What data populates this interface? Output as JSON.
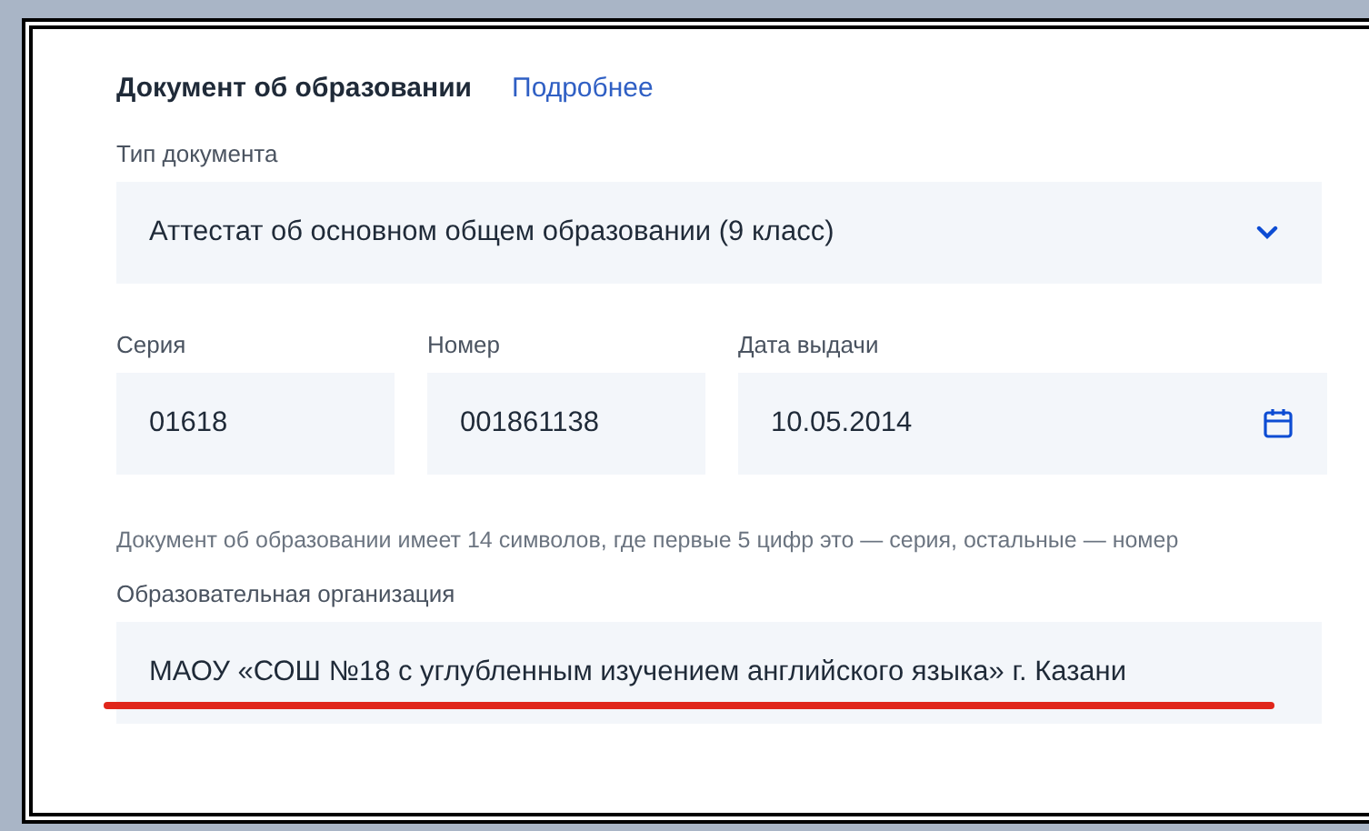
{
  "section": {
    "title": "Документ об образовании",
    "link": "Подробнее"
  },
  "document_type": {
    "label": "Тип документа",
    "value": "Аттестат об основном общем образовании (9 класс)"
  },
  "fields": [
    {
      "label": "Серия",
      "value": "01618",
      "kind": "text"
    },
    {
      "label": "Номер",
      "value": "001861138",
      "kind": "text"
    },
    {
      "label": "Дата выдачи",
      "value": "10.05.2014",
      "kind": "date"
    }
  ],
  "hint": "Документ об образовании имеет 14 символов, где первые 5 цифр это — серия, остальные — номер",
  "organization": {
    "label": "Образовательная организация",
    "value": "МАОУ «СОШ №18 с углубленным изучением английского языка» г. Казани",
    "underlined": true
  }
}
